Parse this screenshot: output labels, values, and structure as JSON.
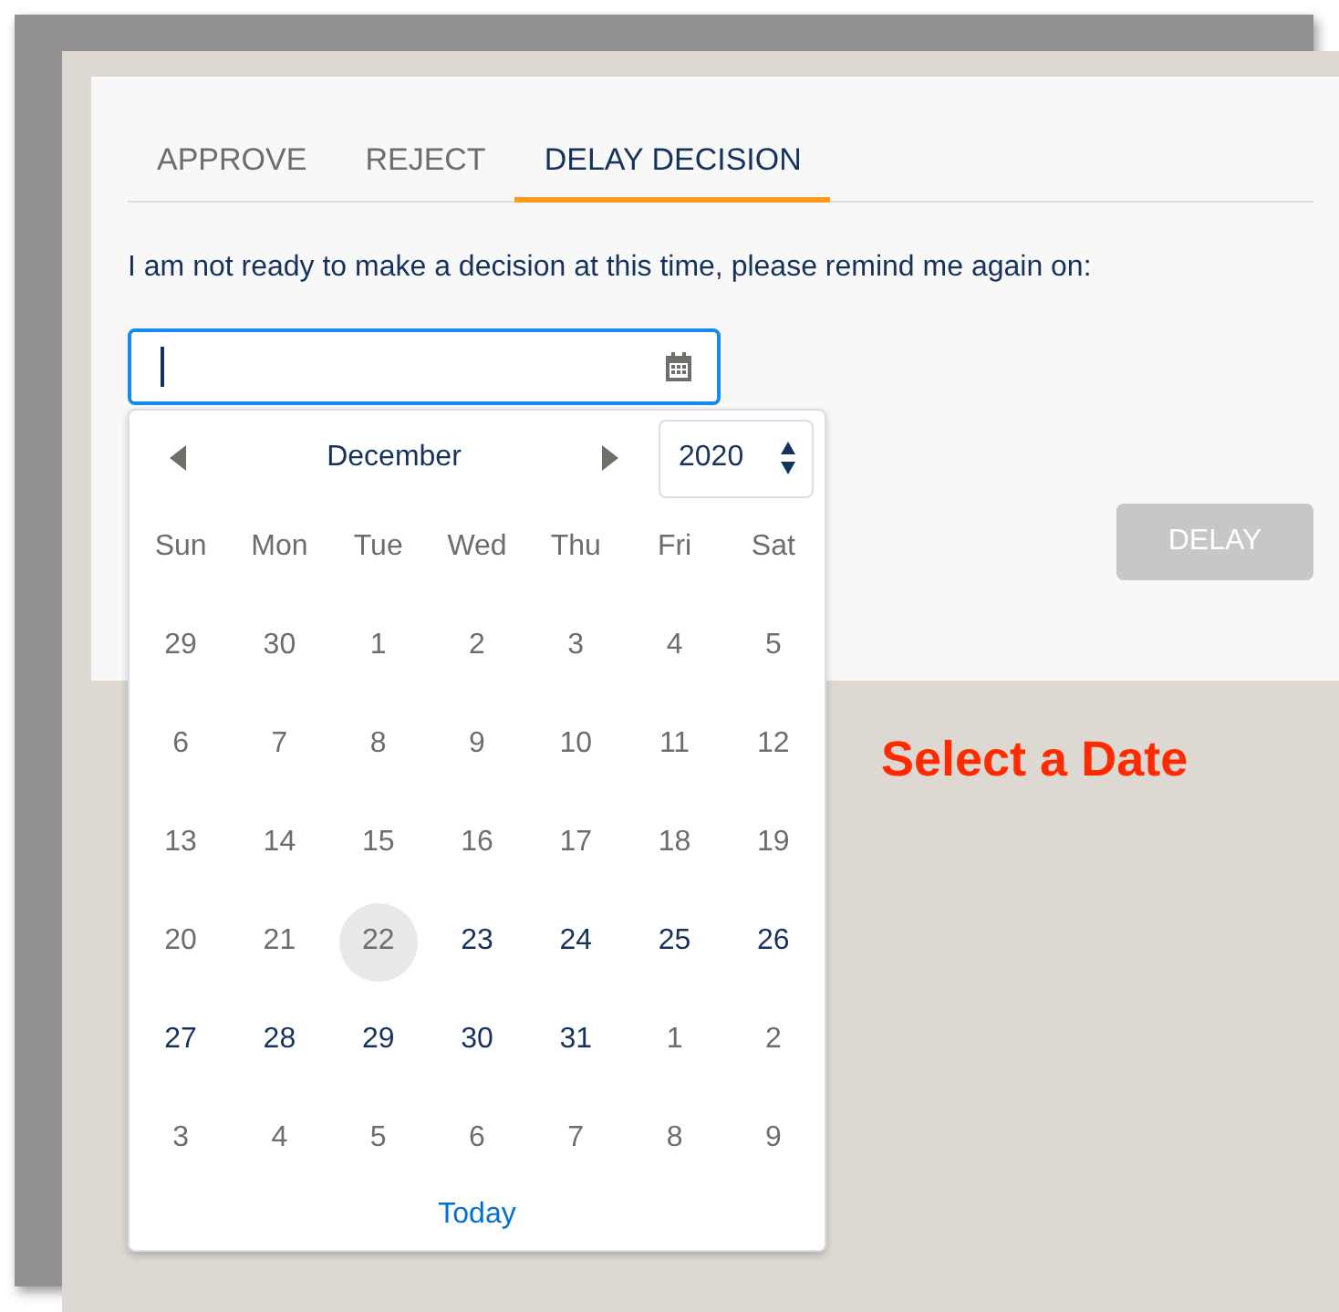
{
  "tabs": [
    {
      "label": "APPROVE",
      "selected": false
    },
    {
      "label": "REJECT",
      "selected": false
    },
    {
      "label": "DELAY DECISION",
      "selected": true
    }
  ],
  "prompt": "I am not ready to make a decision at this time, please remind me again on:",
  "date_picker": {
    "month": "December",
    "year": "2020",
    "weekdays": [
      "Sun",
      "Mon",
      "Tue",
      "Wed",
      "Thu",
      "Fri",
      "Sat"
    ],
    "weeks": [
      {
        "days": [
          {
            "day": "29",
            "kind": "past",
            "today": false
          },
          {
            "day": "30",
            "kind": "past",
            "today": false
          },
          {
            "day": "1",
            "kind": "past",
            "today": false
          },
          {
            "day": "2",
            "kind": "past",
            "today": false
          },
          {
            "day": "3",
            "kind": "past",
            "today": false
          },
          {
            "day": "4",
            "kind": "past",
            "today": false
          },
          {
            "day": "5",
            "kind": "past",
            "today": false
          }
        ]
      },
      {
        "days": [
          {
            "day": "6",
            "kind": "past",
            "today": false
          },
          {
            "day": "7",
            "kind": "past",
            "today": false
          },
          {
            "day": "8",
            "kind": "past",
            "today": false
          },
          {
            "day": "9",
            "kind": "past",
            "today": false
          },
          {
            "day": "10",
            "kind": "past",
            "today": false
          },
          {
            "day": "11",
            "kind": "past",
            "today": false
          },
          {
            "day": "12",
            "kind": "past",
            "today": false
          }
        ]
      },
      {
        "days": [
          {
            "day": "13",
            "kind": "past",
            "today": false
          },
          {
            "day": "14",
            "kind": "past",
            "today": false
          },
          {
            "day": "15",
            "kind": "past",
            "today": false
          },
          {
            "day": "16",
            "kind": "past",
            "today": false
          },
          {
            "day": "17",
            "kind": "past",
            "today": false
          },
          {
            "day": "18",
            "kind": "past",
            "today": false
          },
          {
            "day": "19",
            "kind": "past",
            "today": false
          }
        ]
      },
      {
        "days": [
          {
            "day": "20",
            "kind": "past",
            "today": false
          },
          {
            "day": "21",
            "kind": "past",
            "today": false
          },
          {
            "day": "22",
            "kind": "past",
            "today": true
          },
          {
            "day": "23",
            "kind": "available",
            "today": false
          },
          {
            "day": "24",
            "kind": "available",
            "today": false
          },
          {
            "day": "25",
            "kind": "available",
            "today": false
          },
          {
            "day": "26",
            "kind": "available",
            "today": false
          }
        ]
      },
      {
        "days": [
          {
            "day": "27",
            "kind": "available",
            "today": false
          },
          {
            "day": "28",
            "kind": "available",
            "today": false
          },
          {
            "day": "29",
            "kind": "available",
            "today": false
          },
          {
            "day": "30",
            "kind": "available",
            "today": false
          },
          {
            "day": "31",
            "kind": "available",
            "today": false
          },
          {
            "day": "1",
            "kind": "outside",
            "today": false
          },
          {
            "day": "2",
            "kind": "outside",
            "today": false
          }
        ]
      },
      {
        "days": [
          {
            "day": "3",
            "kind": "outside",
            "today": false
          },
          {
            "day": "4",
            "kind": "outside",
            "today": false
          },
          {
            "day": "5",
            "kind": "outside",
            "today": false
          },
          {
            "day": "6",
            "kind": "outside",
            "today": false
          },
          {
            "day": "7",
            "kind": "outside",
            "today": false
          },
          {
            "day": "8",
            "kind": "outside",
            "today": false
          },
          {
            "day": "9",
            "kind": "outside",
            "today": false
          }
        ]
      }
    ],
    "today_link": "Today"
  },
  "delay_button": {
    "label": "DELAY",
    "disabled": true
  },
  "annotation": "Select a Date"
}
